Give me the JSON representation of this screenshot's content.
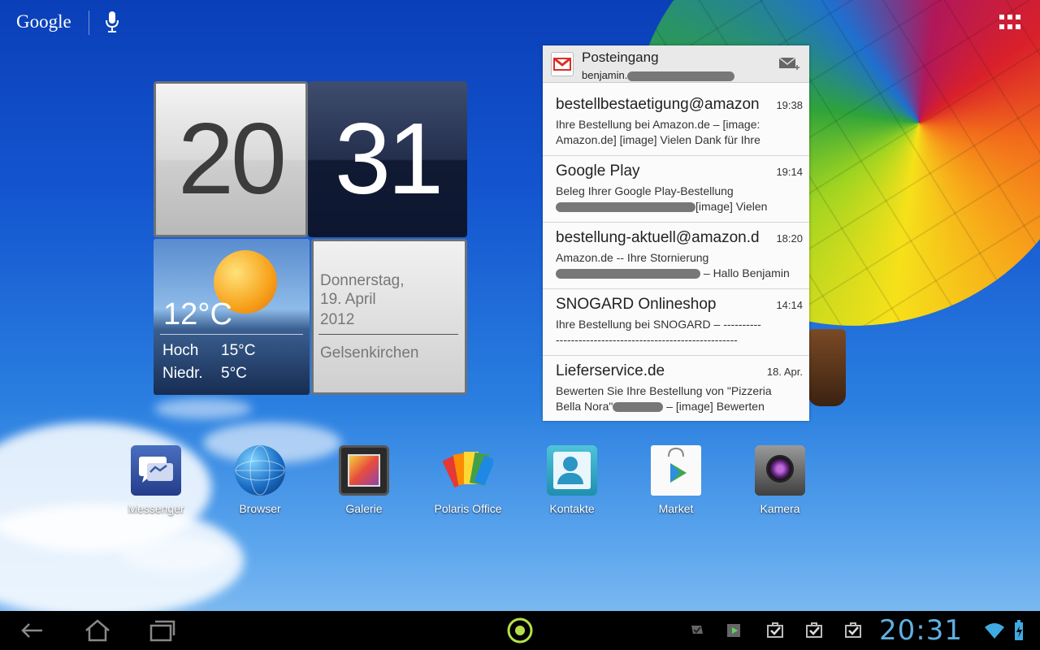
{
  "topbar": {
    "search_label": "Google"
  },
  "clock": {
    "hours": "20",
    "minutes": "31"
  },
  "weather": {
    "temperature": "12°C",
    "high_label": "Hoch",
    "high_value": "15°C",
    "low_label": "Niedr.",
    "low_value": "5°C"
  },
  "date": {
    "weekday": "Donnerstag,",
    "day_month": "19. April",
    "year": "2012",
    "city": "Gelsenkirchen"
  },
  "gmail": {
    "title": "Posteingang",
    "account": "benjamin.",
    "messages": [
      {
        "from": "bestellbestaetigung@amazon.de",
        "time": "19:38",
        "line1": "Ihre Bestellung bei Amazon.de – [image:",
        "line2": "Amazon.de] [image] Vielen Dank für Ihre"
      },
      {
        "from": "Google Play",
        "time": "19:14",
        "line1": "Beleg Ihrer Google Play-Bestellung",
        "line2": "[image] Vielen"
      },
      {
        "from": "bestellung-aktuell@amazon.de",
        "time": "18:20",
        "line1": "Amazon.de -- Ihre Stornierung",
        "line2": "– Hallo Benjamin"
      },
      {
        "from": "SNOGARD Onlineshop",
        "time": "14:14",
        "line1": "Ihre Bestellung bei SNOGARD – ----------",
        "line2": "------------------------------------------------"
      },
      {
        "from": "Lieferservice.de",
        "time": "18. Apr.",
        "line1": "Bewerten Sie Ihre Bestellung von \"Pizzeria",
        "line2": "Bella Nora\"",
        "line2b": "– [image] Bewerten"
      }
    ]
  },
  "apps": [
    {
      "label": "Messenger",
      "icon": "messenger-icon"
    },
    {
      "label": "Browser",
      "icon": "globe-icon"
    },
    {
      "label": "Galerie",
      "icon": "gallery-icon"
    },
    {
      "label": "Polaris Office",
      "icon": "polaris-office-icon"
    },
    {
      "label": "Kontakte",
      "icon": "contacts-icon"
    },
    {
      "label": "Market",
      "icon": "market-bag-icon"
    },
    {
      "label": "Kamera",
      "icon": "camera-icon"
    }
  ],
  "navbar": {
    "clock": "20:31"
  },
  "colors": {
    "accent_blue": "#5fb0e0",
    "gmail_red": "#d93025",
    "nav_bg": "#000000"
  }
}
